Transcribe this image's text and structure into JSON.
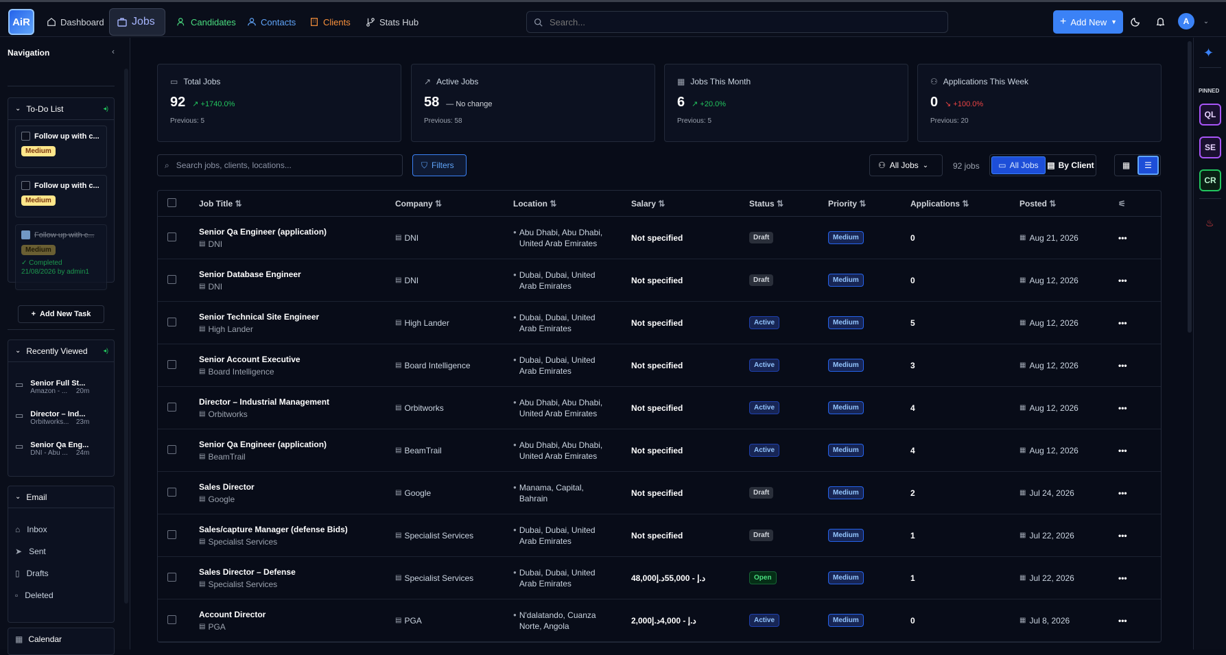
{
  "app": {
    "logo": "AiR"
  },
  "nav": [
    {
      "label": "Dashboard",
      "color": "#d1d5db"
    },
    {
      "label": "Jobs",
      "color": "#a5b4fc"
    },
    {
      "label": "Candidates",
      "color": "#4ade80"
    },
    {
      "label": "Contacts",
      "color": "#60a5fa"
    },
    {
      "label": "Clients",
      "color": "#fb923c"
    },
    {
      "label": "Stats Hub",
      "color": "#d1d5db"
    }
  ],
  "search": {
    "placeholder": "Search..."
  },
  "header": {
    "add_new": "Add New",
    "avatar": "A"
  },
  "sidebar": {
    "title": "Navigation",
    "todo": {
      "title": "To-Do List",
      "tasks": [
        {
          "text": "Follow up with c...",
          "priority": "Medium"
        },
        {
          "text": "Follow up with c...",
          "priority": "Medium"
        },
        {
          "text": "Follow up with c...",
          "priority": "Medium",
          "status": "Completed",
          "by": "21/08/2026 by admin1"
        }
      ],
      "add": "Add New Task"
    },
    "recent": {
      "title": "Recently Viewed",
      "items": [
        {
          "title": "Senior Full St...",
          "sub": "Amazon - ...",
          "time": "20m"
        },
        {
          "title": "Director – Ind...",
          "sub": "Orbitworks...",
          "time": "23m"
        },
        {
          "title": "Senior Qa Eng...",
          "sub": "DNI - Abu ...",
          "time": "24m"
        }
      ]
    },
    "email": {
      "title": "Email",
      "items": [
        "Inbox",
        "Sent",
        "Drafts",
        "Deleted"
      ]
    },
    "calendar": "Calendar"
  },
  "stats": [
    {
      "label": "Total Jobs",
      "value": "92",
      "change": "+1740.0%",
      "trend": "up",
      "prev": "Previous: 5"
    },
    {
      "label": "Active Jobs",
      "value": "58",
      "change": "No change",
      "trend": "flat",
      "prev": "Previous: 58"
    },
    {
      "label": "Jobs This Month",
      "value": "6",
      "change": "+20.0%",
      "trend": "up",
      "prev": "Previous: 5"
    },
    {
      "label": "Applications This Week",
      "value": "0",
      "change": "+100.0%",
      "trend": "down",
      "prev": "Previous: 20"
    }
  ],
  "toolbar": {
    "search_placeholder": "Search jobs, clients, locations...",
    "filters": "Filters",
    "scope": "All Jobs",
    "count": "92 jobs",
    "view_all": "All Jobs",
    "view_client": "By Client"
  },
  "columns": [
    "Job Title",
    "Company",
    "Location",
    "Salary",
    "Status",
    "Priority",
    "Applications",
    "Posted"
  ],
  "rows": [
    {
      "title": "Senior Qa Engineer (application)",
      "company": "DNI",
      "loc1": "Abu Dhabi, Abu Dhabi,",
      "loc2": "United Arab Emirates",
      "salary": "Not specified",
      "status": "Draft",
      "priority": "Medium",
      "apps": "0",
      "posted": "Aug 21, 2026"
    },
    {
      "title": "Senior Database Engineer",
      "company": "DNI",
      "loc1": "Dubai, Dubai, United",
      "loc2": "Arab Emirates",
      "salary": "Not specified",
      "status": "Draft",
      "priority": "Medium",
      "apps": "0",
      "posted": "Aug 12, 2026"
    },
    {
      "title": "Senior Technical Site Engineer",
      "company": "High Lander",
      "loc1": "Dubai, Dubai, United",
      "loc2": "Arab Emirates",
      "salary": "Not specified",
      "status": "Active",
      "priority": "Medium",
      "apps": "5",
      "posted": "Aug 12, 2026"
    },
    {
      "title": "Senior Account Executive",
      "company": "Board Intelligence",
      "loc1": "Dubai, Dubai, United",
      "loc2": "Arab Emirates",
      "salary": "Not specified",
      "status": "Active",
      "priority": "Medium",
      "apps": "3",
      "posted": "Aug 12, 2026"
    },
    {
      "title": "Director – Industrial Management",
      "company": "Orbitworks",
      "loc1": "Abu Dhabi, Abu Dhabi,",
      "loc2": "United Arab Emirates",
      "salary": "Not specified",
      "status": "Active",
      "priority": "Medium",
      "apps": "4",
      "posted": "Aug 12, 2026"
    },
    {
      "title": "Senior Qa Engineer (application)",
      "company": "BeamTrail",
      "loc1": "Abu Dhabi, Abu Dhabi,",
      "loc2": "United Arab Emirates",
      "salary": "Not specified",
      "status": "Active",
      "priority": "Medium",
      "apps": "4",
      "posted": "Aug 12, 2026"
    },
    {
      "title": "Sales Director",
      "company": "Google",
      "loc1": "Manama, Capital,",
      "loc2": "Bahrain",
      "salary": "Not specified",
      "status": "Draft",
      "priority": "Medium",
      "apps": "2",
      "posted": "Jul 24, 2026"
    },
    {
      "title": "Sales/capture Manager (defense Bids)",
      "company": "Specialist Services",
      "loc1": "Dubai, Dubai, United",
      "loc2": "Arab Emirates",
      "salary": "Not specified",
      "status": "Draft",
      "priority": "Medium",
      "apps": "1",
      "posted": "Jul 22, 2026"
    },
    {
      "title": "Sales Director – Defense",
      "company": "Specialist Services",
      "loc1": "Dubai, Dubai, United",
      "loc2": "Arab Emirates",
      "salary": "48,000د.إ - 55,000د.إ",
      "status": "Open",
      "priority": "Medium",
      "apps": "1",
      "posted": "Jul 22, 2026"
    },
    {
      "title": "Account Director",
      "company": "PGA",
      "loc1": "N'dalatando, Cuanza",
      "loc2": "Norte, Angola",
      "salary": "2,000د.إ - 4,000د.إ",
      "status": "Active",
      "priority": "Medium",
      "apps": "0",
      "posted": "Jul 8, 2026"
    }
  ],
  "rail": {
    "pinned": "PINNED",
    "pins": [
      {
        "label": "QL",
        "color": "#a855f7"
      },
      {
        "label": "SE",
        "color": "#a855f7"
      },
      {
        "label": "CR",
        "color": "#22c55e"
      }
    ]
  }
}
